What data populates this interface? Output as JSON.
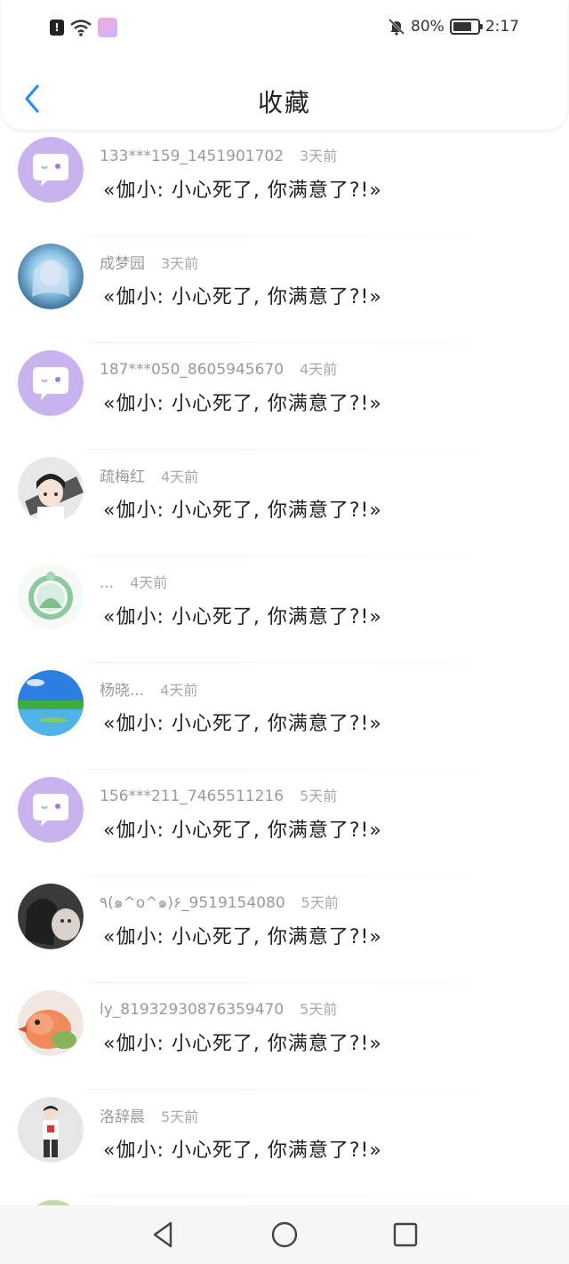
{
  "status_bar": {
    "battery_percent": "80%",
    "battery_level": 0.8,
    "time": "2:17",
    "icons": [
      "alert-icon",
      "wifi-icon",
      "app-badge-icon",
      "bell-muted-icon",
      "battery-icon"
    ]
  },
  "header": {
    "title": "收藏",
    "back_icon": "chevron-left-icon",
    "accent_color": "#2a8cf0"
  },
  "items": [
    {
      "username": "133***159_1451901702",
      "time": "3天前",
      "quote": "«伽小: 小心死了, 你满意了?!»",
      "avatar": "chat-bubble"
    },
    {
      "username": "成梦园",
      "time": "3天前",
      "quote": "«伽小: 小心死了, 你满意了?!»",
      "avatar": "anime-girl"
    },
    {
      "username": "187***050_8605945670",
      "time": "4天前",
      "quote": "«伽小: 小心死了, 你满意了?!»",
      "avatar": "chat-bubble"
    },
    {
      "username": "疏梅红",
      "time": "4天前",
      "quote": "«伽小: 小心死了, 你满意了?!»",
      "avatar": "anime-boy"
    },
    {
      "username": "...",
      "time": "4天前",
      "quote": "«伽小: 小心死了, 你满意了?!»",
      "avatar": "green-wreath"
    },
    {
      "username": "杨晓...",
      "time": "4天前",
      "quote": "«伽小: 小心死了, 你满意了?!»",
      "avatar": "landscape"
    },
    {
      "username": "156***211_7465511216",
      "time": "5天前",
      "quote": "«伽小: 小心死了, 你满意了?!»",
      "avatar": "chat-bubble"
    },
    {
      "username": "٩(๑^o^๑)۶_9519154080",
      "time": "5天前",
      "quote": "«伽小: 小心死了, 你满意了?!»",
      "avatar": "girl-cat"
    },
    {
      "username": "ly_81932930876359470",
      "time": "5天前",
      "quote": "«伽小: 小心死了, 你满意了?!»",
      "avatar": "bird"
    },
    {
      "username": "洛辞晨",
      "time": "5天前",
      "quote": "«伽小: 小心死了, 你满意了?!»",
      "avatar": "person-red"
    }
  ],
  "system_nav": {
    "back": "triangle-back-icon",
    "home": "circle-home-icon",
    "recents": "square-recents-icon"
  }
}
